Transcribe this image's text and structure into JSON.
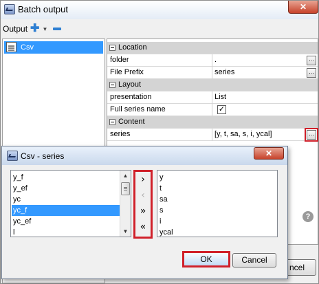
{
  "main_window": {
    "title": "Batch output",
    "close_glyph": "✕",
    "toolbar": {
      "label": "Output",
      "add_icon": "plus-icon",
      "menu_icon": "caret-down-icon",
      "remove_icon": "minus-icon"
    },
    "tree": {
      "items": [
        {
          "label": "Csv",
          "icon": "csv-icon",
          "selected": true
        }
      ]
    },
    "properties": {
      "sections": [
        {
          "title": "Location",
          "rows": [
            {
              "key": "folder",
              "value": "."
            },
            {
              "key": "File Prefix",
              "value": "series"
            }
          ]
        },
        {
          "title": "Layout",
          "rows": [
            {
              "key": "presentation",
              "value": "List"
            },
            {
              "key": "Full series name",
              "checked": true
            }
          ]
        },
        {
          "title": "Content",
          "rows": [
            {
              "key": "series",
              "value": "[y, t, sa, s, i, ycal]"
            }
          ]
        }
      ],
      "ellipsis_label": "..."
    },
    "help_icon": "?",
    "cancel_partial": "ncel"
  },
  "dialog": {
    "title": "Csv - series",
    "close_glyph": "✕",
    "available": [
      "y_f",
      "y_ef",
      "yc",
      "yc_f",
      "yc_ef",
      "l"
    ],
    "selected_index": 3,
    "chosen": [
      "y",
      "t",
      "sa",
      "s",
      "i",
      "ycal"
    ],
    "move_buttons": [
      {
        "glyph": "›",
        "enabled": true
      },
      {
        "glyph": "‹",
        "enabled": false
      },
      {
        "glyph": "»",
        "enabled": true
      },
      {
        "glyph": "«",
        "enabled": true
      }
    ],
    "ok_label": "OK",
    "cancel_label": "Cancel"
  },
  "colors": {
    "highlight": "#d0202a",
    "selection": "#3399ff",
    "accent": "#2e7fd2"
  }
}
